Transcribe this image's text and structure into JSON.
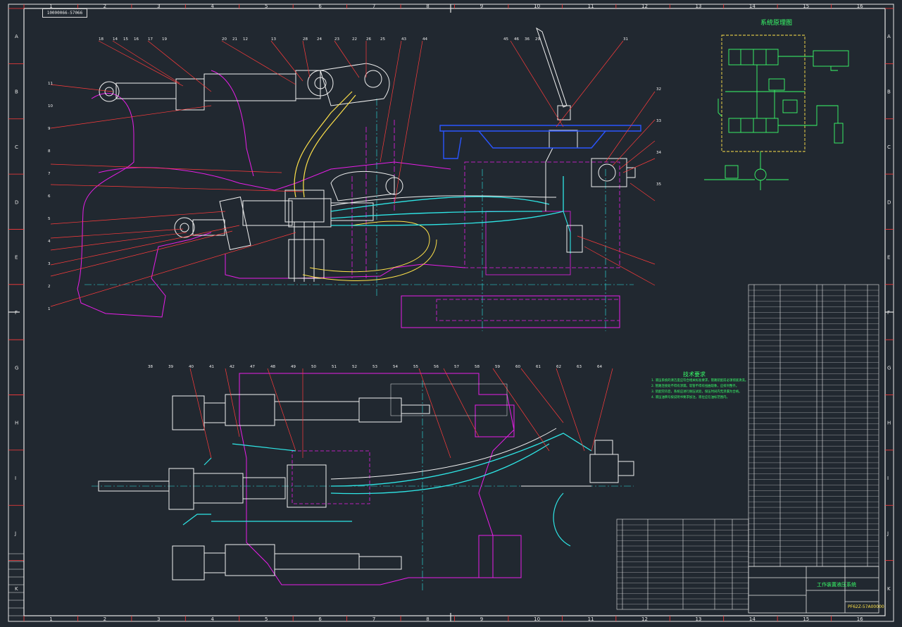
{
  "drawing": {
    "stamp_number": "10000066-57066",
    "drawing_no": "PF62Z-57A00000",
    "title": "工作装置液压系统",
    "schematic_title": "系统原理图",
    "tech_notes_title": "技术要求",
    "tech_notes": [
      "1. 液压系统的清洁度应符合相关标准要求，管路装配前必须彻底清洗。",
      "2. 管路连接处不得有渗漏，软管不得有扭曲现象，应排列整齐。",
      "3. 装配完毕后，系统应进行耐压试验，保压时间内无渗漏为合格。",
      "4. 液压油牌号按说明书要求加注，液位应在油标范围内。"
    ]
  },
  "border": {
    "columns": [
      "1",
      "2",
      "3",
      "4",
      "5",
      "6",
      "7",
      "8",
      "9",
      "10",
      "11",
      "12",
      "13",
      "14",
      "15",
      "16"
    ],
    "rows": [
      "A",
      "B",
      "C",
      "D",
      "E",
      "F",
      "G",
      "H",
      "I",
      "J",
      "K"
    ]
  },
  "top_callouts": [
    "18",
    "14",
    "15",
    "16",
    "17",
    "19",
    "20",
    "21",
    "12",
    "13",
    "28",
    "24",
    "23",
    "22",
    "26",
    "25",
    "43",
    "44",
    "45",
    "46",
    "36",
    "29",
    "31",
    "32",
    "33",
    "34",
    "35"
  ],
  "left_callouts": [
    "11",
    "10",
    "9",
    "8",
    "7",
    "6",
    "5",
    "4",
    "3",
    "2",
    "1"
  ],
  "bottom_callouts": [
    "38",
    "39",
    "40",
    "41",
    "42",
    "47",
    "48",
    "49",
    "50",
    "51",
    "52",
    "53",
    "54",
    "55",
    "56",
    "57",
    "58",
    "59",
    "60",
    "61",
    "62",
    "63",
    "64"
  ],
  "colors": {
    "background": "#212830",
    "frame": "#e6e6e6",
    "grid_red": "#ff3b3b",
    "magenta": "#e81ee8",
    "green": "#39ff6a",
    "yellow": "#ffe24a",
    "cyan": "#2ee6e6",
    "blue": "#2a55ff",
    "white": "#f0f0f0"
  }
}
